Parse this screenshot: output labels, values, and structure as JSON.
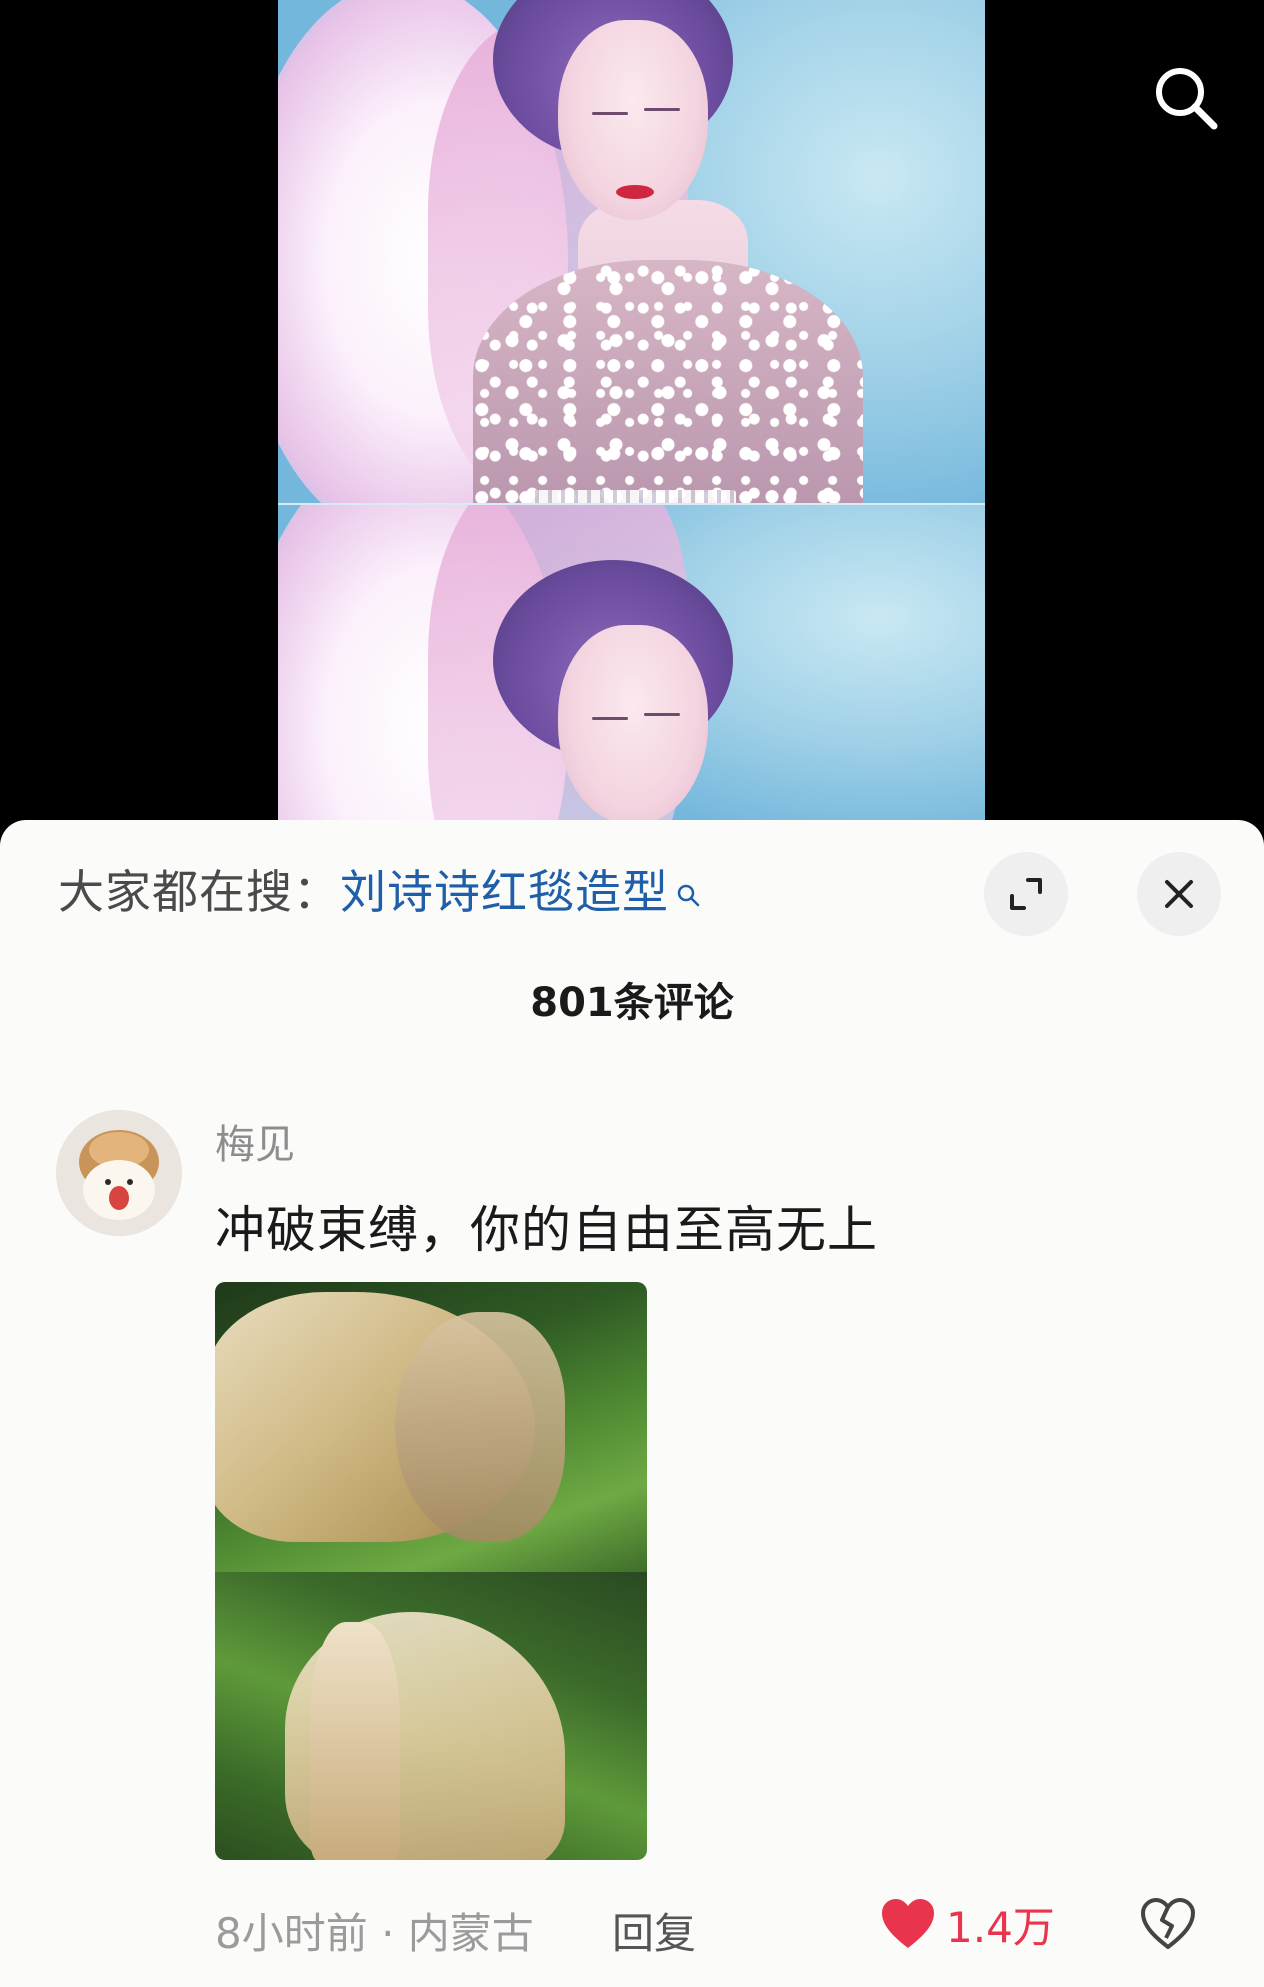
{
  "video": {
    "search_icon": "search-icon"
  },
  "hot_search": {
    "prefix": "大家都在搜：",
    "term": "刘诗诗红毯造型",
    "icon": "search-small-icon",
    "color": "#1f5ea8"
  },
  "sheet": {
    "expand_icon": "expand-icon",
    "close_icon": "close-icon",
    "comment_count": "801条评论"
  },
  "comment": {
    "username": "梅见",
    "text": "冲破束缚，你的自由至高无上",
    "time_location": "8小时前 · 内蒙古",
    "reply_label": "回复",
    "like_count": "1.4万",
    "like_color": "#e8344d",
    "like_icon": "heart-icon",
    "dislike_icon": "broken-heart-icon"
  }
}
